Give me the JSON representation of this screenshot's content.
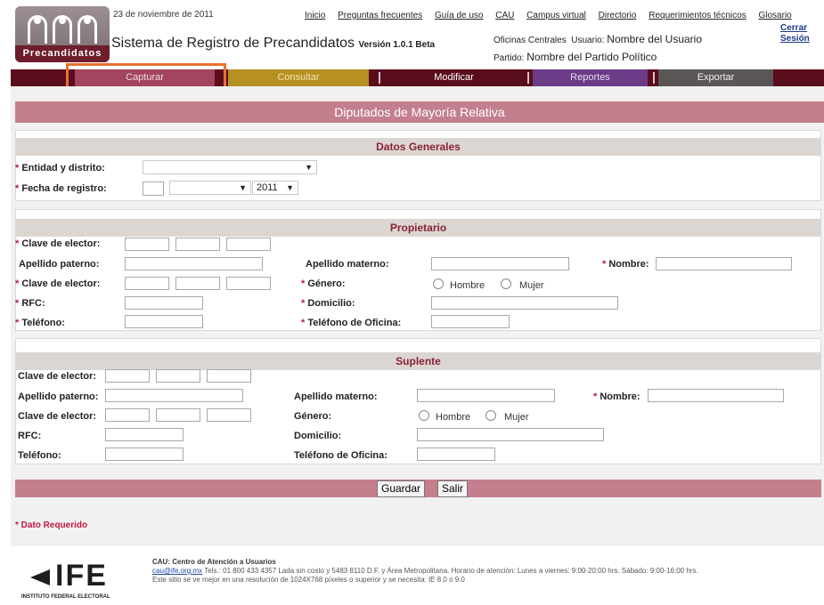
{
  "header": {
    "logo_label": "Precandidatos",
    "date": "23 de noviembre de 2011",
    "app_title": "Sistema de Registro de Precandidatos",
    "version": "Versión 1.0.1 Beta",
    "links": [
      "Inicio",
      "Preguntas frecuentes",
      "Guía de uso",
      "CAU",
      "Campus virtual",
      "Directorio",
      "Requerimientos técnicos",
      "Glosario"
    ],
    "office_label": "Oficinas Centrales",
    "user_label": "Usuario:",
    "user_value": "Nombre del Usuario",
    "party_label": "Partido:",
    "party_value": "Nombre del Partido Político",
    "logout_line1": "Cerrar",
    "logout_line2": "Sesión"
  },
  "nav": {
    "items": [
      {
        "label": "Capturar",
        "color": "#f0d9dc",
        "bg": "#a3455e"
      },
      {
        "label": "Consultar",
        "color": "#f3e3a8",
        "bg": "#b79023"
      },
      {
        "label": "Modificar",
        "color": "#ffffff",
        "bg": "#5a0d1d"
      },
      {
        "label": "Reportes",
        "color": "#e6dcf2",
        "bg": "#6a3b86"
      },
      {
        "label": "Exportar",
        "color": "#f0f0f0",
        "bg": "#5b5656"
      }
    ]
  },
  "page_title": "Diputados de Mayoría Relativa",
  "datos_generales": {
    "title": "Datos Generales",
    "entidad_label": "Entidad y distrito:",
    "fecha_label": "Fecha de registro:",
    "year": "2011"
  },
  "propietario": {
    "title": "Propietario",
    "clave1": "Clave de elector:",
    "apellido_paterno": "Apellido paterno:",
    "apellido_materno": "Apellido materno:",
    "nombre": "Nombre:",
    "clave2": "Clave de elector:",
    "genero": "Género:",
    "hombre": "Hombre",
    "mujer": "Mujer",
    "rfc": "RFC:",
    "domicilio": "Domicilio:",
    "telefono": "Teléfono:",
    "telefono_oficina": "Teléfono de Oficina:"
  },
  "suplente": {
    "title": "Suplente",
    "clave1": "Clave de elector:",
    "apellido_paterno": "Apellido paterno:",
    "apellido_materno": "Apellido materno:",
    "nombre": "Nombre:",
    "clave2": "Clave de elector:",
    "genero": "Género:",
    "hombre": "Hombre",
    "mujer": "Mujer",
    "rfc": "RFC:",
    "domicilio": "Domicilio:",
    "telefono": "Teléfono:",
    "telefono_oficina": "Teléfono de Oficina:"
  },
  "actions": {
    "save": "Guardar",
    "exit": "Salir"
  },
  "required_note": "* Dato Requerido",
  "footer": {
    "ife_big": "IFE",
    "ife_small": "INSTITUTO FEDERAL ELECTORAL",
    "cau_title": "CAU: Centro de Atención a Usuarios",
    "email": "cau@ife.org.mx",
    "contact": " Tels.: 01 800 433 4357 Lada sin costo y 5483 8110 D.F. y Área Metropolitana. Horario de atención: Lunes a viernes: 9:00-20:00 hrs. Sábado: 9:00-16:00 hrs.",
    "resolution": "Este sitio se ve mejor en una resolución de 1024X768 píxeles o superior y se necesita: IE 8.0 o 9.0"
  }
}
